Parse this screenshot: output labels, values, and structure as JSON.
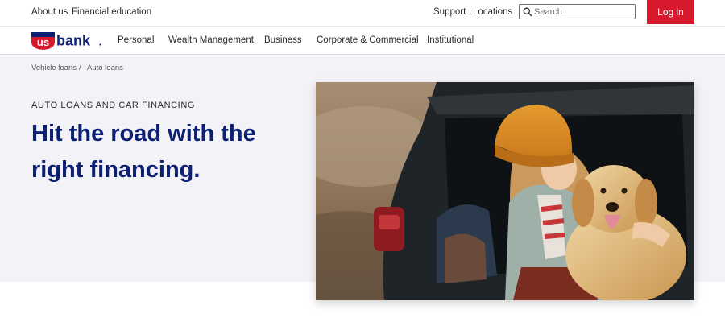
{
  "utility_nav": {
    "about": "About us",
    "education": "Financial education",
    "support": "Support",
    "locations": "Locations",
    "search_placeholder": "Search",
    "login": "Log in"
  },
  "brand": {
    "logo_us": "us",
    "logo_bank": "bank",
    "logo_alt": "U.S. Bank"
  },
  "main_nav": [
    "Personal",
    "Wealth Management",
    "Business",
    "Corporate & Commercial",
    "Institutional"
  ],
  "breadcrumb": {
    "parent": "Vehicle loans",
    "separator": "/",
    "current": "Auto loans"
  },
  "hero": {
    "eyebrow": "AUTO LOANS AND CAR FINANCING",
    "headline": "Hit the road with the right financing.",
    "image_alt": "Woman in an orange knit hat hugging a golden retriever in the open trunk of a car"
  },
  "colors": {
    "brand_navy": "#0c2074",
    "brand_red": "#d7192d",
    "hero_bg": "#f2f2f7"
  }
}
